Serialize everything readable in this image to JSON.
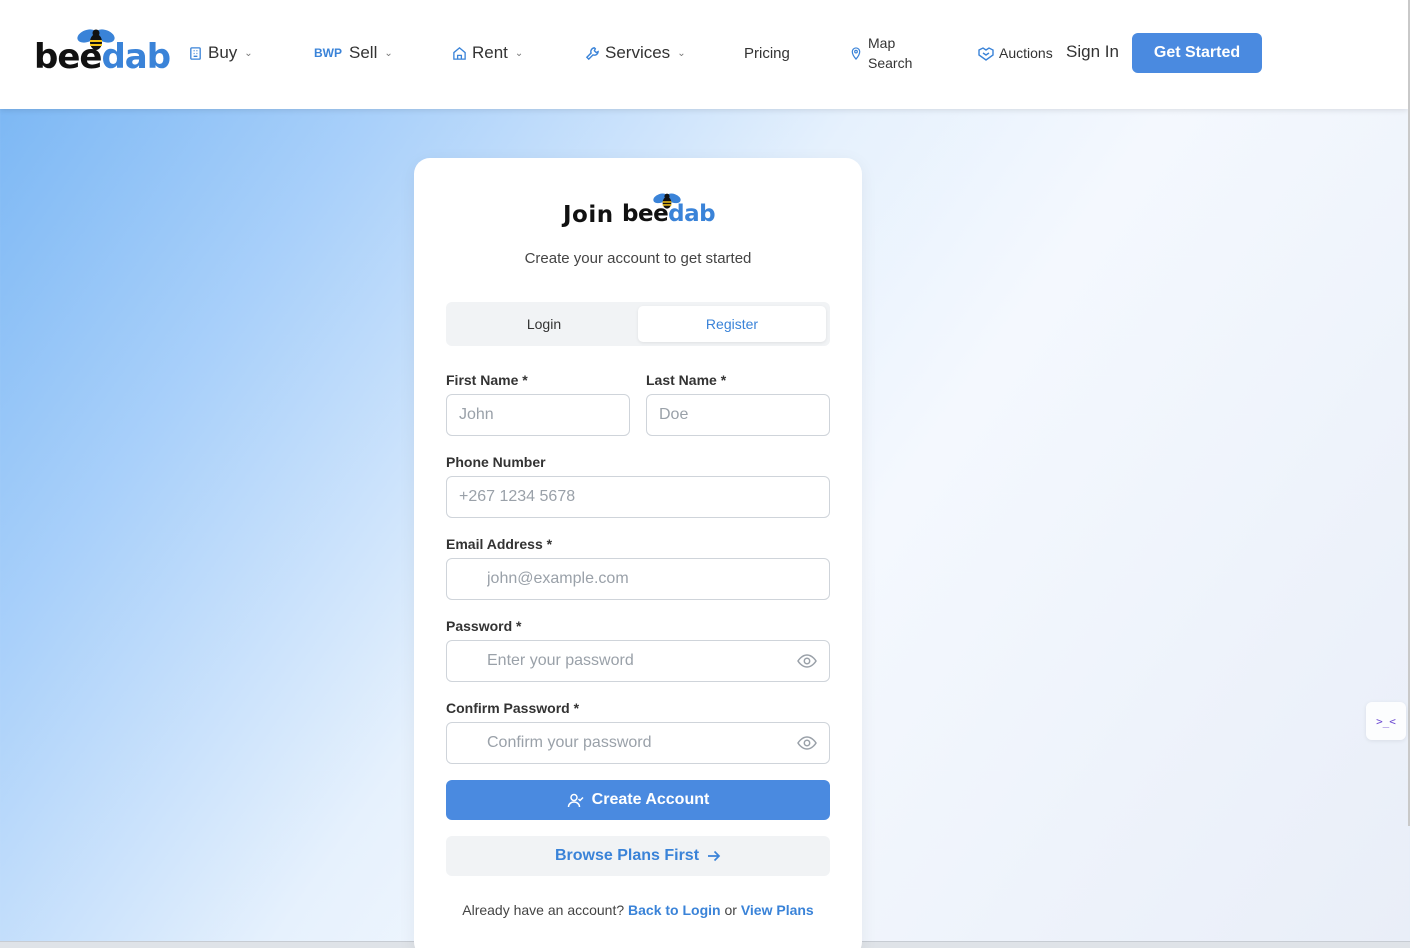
{
  "header": {
    "logo": {
      "part1": "bee",
      "part2": "dab"
    },
    "nav": {
      "buy": "Buy",
      "sell_prefix": "BWP",
      "sell": "Sell",
      "rent": "Rent",
      "services": "Services",
      "pricing": "Pricing",
      "map_search_line1": "Map",
      "map_search_line2": "Search",
      "auctions": "Auctions"
    },
    "sign_in": "Sign In",
    "get_started": "Get Started"
  },
  "card": {
    "title_prefix": "Join",
    "logo": {
      "part1": "bee",
      "part2": "dab"
    },
    "subtitle": "Create your account to get started",
    "tabs": {
      "login": "Login",
      "register": "Register",
      "active": "register"
    },
    "form": {
      "first_name": {
        "label": "First Name *",
        "placeholder": "John",
        "value": ""
      },
      "last_name": {
        "label": "Last Name *",
        "placeholder": "Doe",
        "value": ""
      },
      "phone": {
        "label": "Phone Number",
        "placeholder": "+267 1234 5678",
        "value": ""
      },
      "email": {
        "label": "Email Address *",
        "placeholder": "john@example.com",
        "value": ""
      },
      "password": {
        "label": "Password *",
        "placeholder": "Enter your password",
        "value": ""
      },
      "confirm_password": {
        "label": "Confirm Password *",
        "placeholder": "Confirm your password",
        "value": ""
      }
    },
    "create_account": "Create Account",
    "browse_plans": "Browse Plans First",
    "footer": {
      "text": "Already have an account?",
      "back_to_login": "Back to Login",
      "or": "or",
      "view_plans": "View Plans"
    }
  },
  "widget": {
    "label": ">_<"
  },
  "colors": {
    "accent": "#4a8ae0",
    "link": "#3a83d8",
    "text": "#333333"
  }
}
